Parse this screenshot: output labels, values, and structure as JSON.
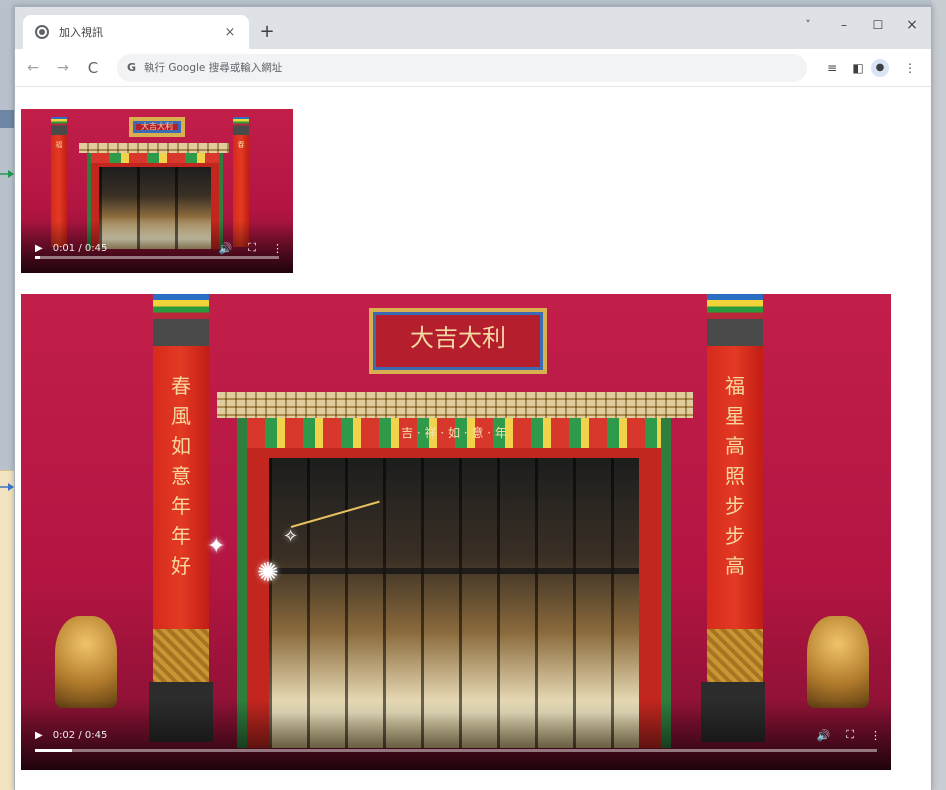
{
  "browser": {
    "tab_title": "加入視訊",
    "tab_close": "×",
    "new_tab": "+",
    "window_controls": {
      "tab_search": "˅",
      "minimize": "–",
      "maximize": "☐",
      "close": "×"
    },
    "nav": {
      "back": "←",
      "forward": "→",
      "reload": "C"
    },
    "omnibox_icon": "G",
    "omnibox_placeholder": "執行 Google 搜尋或輸入網址",
    "toolbar_icons": [
      "media-control-icon",
      "side-panel-icon",
      "profile-icon",
      "menu-icon"
    ]
  },
  "videos": [
    {
      "id": "small",
      "time_label": "0:01 / 0:45",
      "progress": 0.022,
      "plaque_text": "大吉大利",
      "left_couplet": "福",
      "right_couplet": "春"
    },
    {
      "id": "large",
      "time_label": "0:02 / 0:45",
      "progress": 0.044,
      "plaque_text": "大吉大利",
      "band_text": "吉 · 祥 · 如 · 意 · 年",
      "left_couplet": "春 風 如 意 年 年 好",
      "right_couplet": "福 星 高 照 步 步 高"
    }
  ],
  "colors": {
    "wall": "#b31542",
    "pillar": "#d62a1c",
    "gold": "#d9b04f"
  }
}
